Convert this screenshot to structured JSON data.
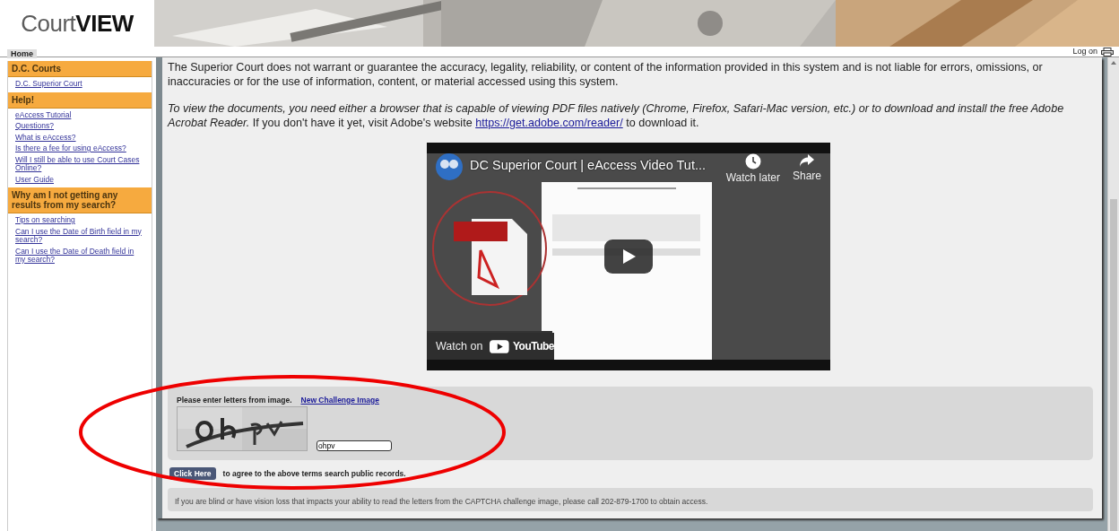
{
  "header": {
    "logo": "Court**VIEW**"
  },
  "nav": {
    "tabs": [
      {
        "label": "Home",
        "selected": true
      }
    ],
    "log_on": "Log on"
  },
  "sidebar": {
    "sections": [
      {
        "heading": "D.C. Courts",
        "links": [
          "D.C. Superior Court"
        ]
      },
      {
        "heading": "Help!",
        "links": [
          "eAccess Tutorial",
          "Questions?",
          "What is eAccess?",
          "Is there a fee for using eAccess?",
          "Will I still be able to use Court Cases Online?",
          "User Guide"
        ]
      },
      {
        "heading": "Why am I not getting any results from my search?",
        "links": [
          "Tips on searching",
          "Can I use the Date of Birth field in my search?",
          "Can I use the Date of Death field in my search?"
        ]
      }
    ]
  },
  "content": {
    "disclaimer": "The Superior Court does not warrant or guarantee the accuracy, legality, reliability, or content of the information provided in this system and is not liable for errors, omissions, or inaccuracies or for the use of information, content, or material accessed using this system.",
    "pdf_note": {
      "text": "*To view the documents, you need either a browser that is capable of viewing PDF files natively (Chrome, Firefox, Safari-Mac version, etc.) or to download and install the free Adobe Acrobat Reader.* If you don't have it yet, visit Adobe's website ",
      "link": "https://get.adobe.com/reader/",
      "after": " to download it."
    },
    "video": {
      "kind": "picture",
      "title": "DC Superior Court | eAccess Video Tut...",
      "watch_later": "Watch later",
      "share": "Share",
      "watch_on": "Watch on",
      "brand": "YouTube"
    },
    "captcha": {
      "prompt": "Please enter letters from image.",
      "new_image_link": "New Challenge Image",
      "answer": "ohpv"
    },
    "agree": {
      "button": "Click Here",
      "text": "to agree to the above terms search public records."
    },
    "accessibility_note": "If you are blind or have vision loss that impacts your ability to read the letters from the CAPTCHA challenge image, please call 202-879-1700 to obtain access."
  }
}
